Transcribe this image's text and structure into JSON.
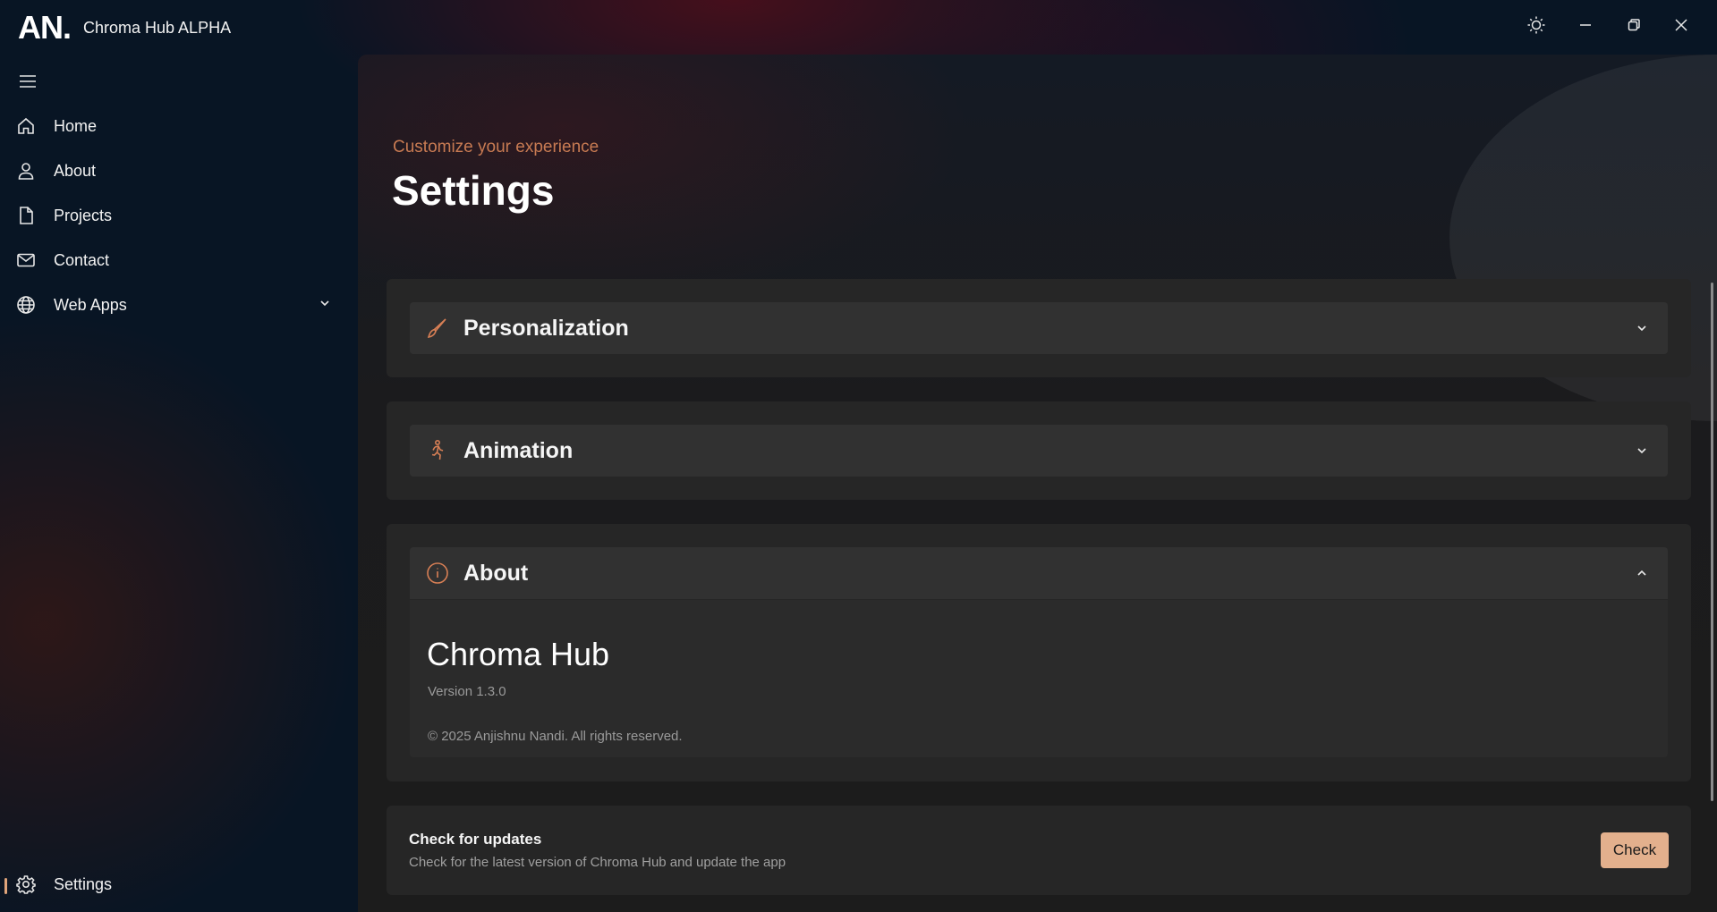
{
  "titlebar": {
    "logo": "AN.",
    "app_title": "Chroma Hub ALPHA"
  },
  "sidebar": {
    "items": [
      {
        "label": "Home",
        "icon": "home-icon"
      },
      {
        "label": "About",
        "icon": "person-icon"
      },
      {
        "label": "Projects",
        "icon": "document-icon"
      },
      {
        "label": "Contact",
        "icon": "mail-icon"
      },
      {
        "label": "Web Apps",
        "icon": "globe-icon"
      }
    ],
    "footer_item": {
      "label": "Settings",
      "icon": "gear-icon"
    }
  },
  "page": {
    "subtitle": "Customize your experience",
    "title": "Settings"
  },
  "sections": {
    "personalization": {
      "label": "Personalization",
      "icon": "paintbrush-icon",
      "expanded": false
    },
    "animation": {
      "label": "Animation",
      "icon": "running-person-icon",
      "expanded": false
    },
    "about": {
      "label": "About",
      "icon": "info-icon",
      "expanded": true,
      "app_name": "Chroma Hub",
      "version": "Version 1.3.0",
      "copyright": "© 2025 Anjishnu Nandi. All rights reserved."
    }
  },
  "updates": {
    "title": "Check for updates",
    "description": "Check for the latest version of Chroma Hub and update the app",
    "button": "Check"
  },
  "colors": {
    "accent": "#d77f55",
    "button_bg": "#e3b08d",
    "card_bg": "#262626",
    "expander_bg": "#313131"
  }
}
